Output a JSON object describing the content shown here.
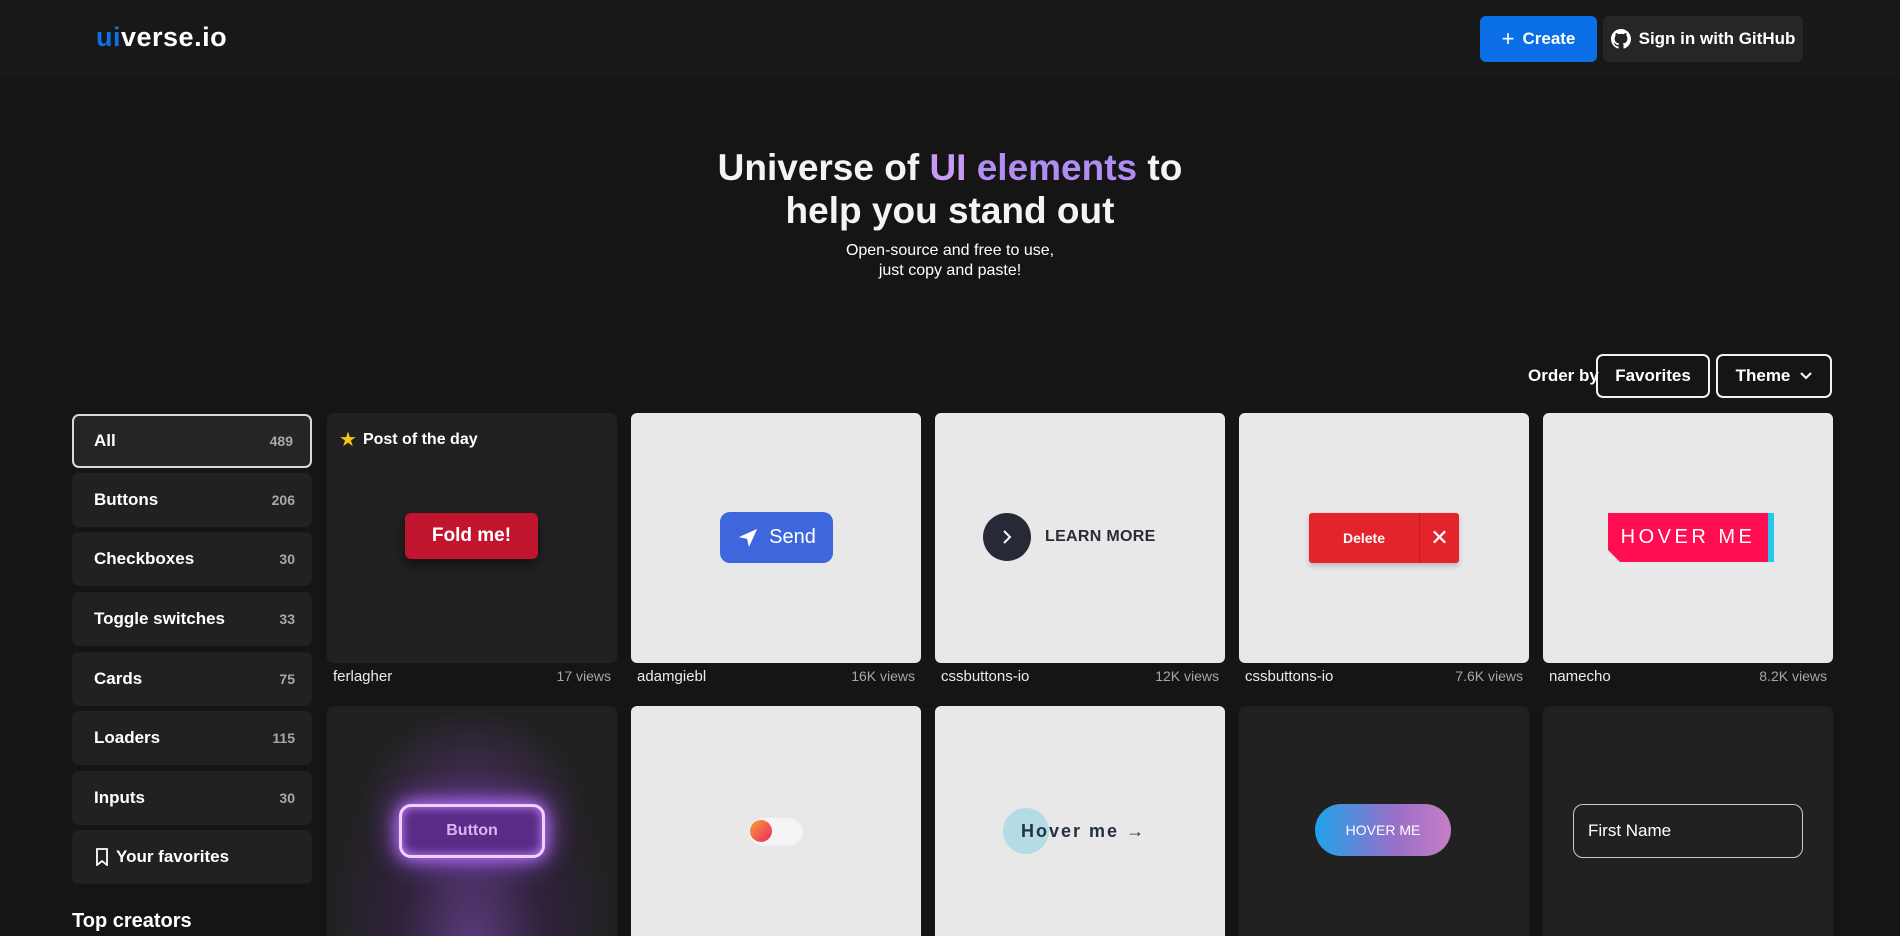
{
  "header": {
    "logo_prefix": "ui",
    "logo_rest": "verse.io",
    "create_label": "Create",
    "github_label": "Sign in with GitHub"
  },
  "hero": {
    "title_part1": "Universe of ",
    "title_ui": "UI",
    "title_elements": " elements",
    "title_part2": " to",
    "title_line2": "help you stand out",
    "sub_line1": "Open-source and free to use,",
    "sub_line2": "just copy and paste!"
  },
  "order": {
    "label": "Order by",
    "favorites_label": "Favorites",
    "theme_label": "Theme"
  },
  "sidebar": {
    "items": [
      {
        "label": "All",
        "count": "489"
      },
      {
        "label": "Buttons",
        "count": "206"
      },
      {
        "label": "Checkboxes",
        "count": "30"
      },
      {
        "label": "Toggle switches",
        "count": "33"
      },
      {
        "label": "Cards",
        "count": "75"
      },
      {
        "label": "Loaders",
        "count": "115"
      },
      {
        "label": "Inputs",
        "count": "30"
      }
    ],
    "favorites_label": "Your favorites",
    "top_creators": "Top creators"
  },
  "cards": [
    {
      "author": "ferlagher",
      "views": "17 views",
      "badge": "Post of the day",
      "widget": "Fold me!"
    },
    {
      "author": "adamgiebl",
      "views": "16K views",
      "widget": "Send"
    },
    {
      "author": "cssbuttons-io",
      "views": "12K views",
      "widget": "LEARN MORE"
    },
    {
      "author": "cssbuttons-io",
      "views": "7.6K views",
      "widget": "Delete"
    },
    {
      "author": "namecho",
      "views": "8.2K views",
      "widget": "HOVER ME"
    },
    {
      "widget": "Button"
    },
    {
      "widget": ""
    },
    {
      "widget": "Hover me"
    },
    {
      "widget": "HOVER ME"
    },
    {
      "widget": "First Name"
    }
  ],
  "colors": {
    "accent": "#0a6ee6",
    "background": "#151515",
    "card_dark": "#212121",
    "card_light": "#e8e8e8"
  }
}
